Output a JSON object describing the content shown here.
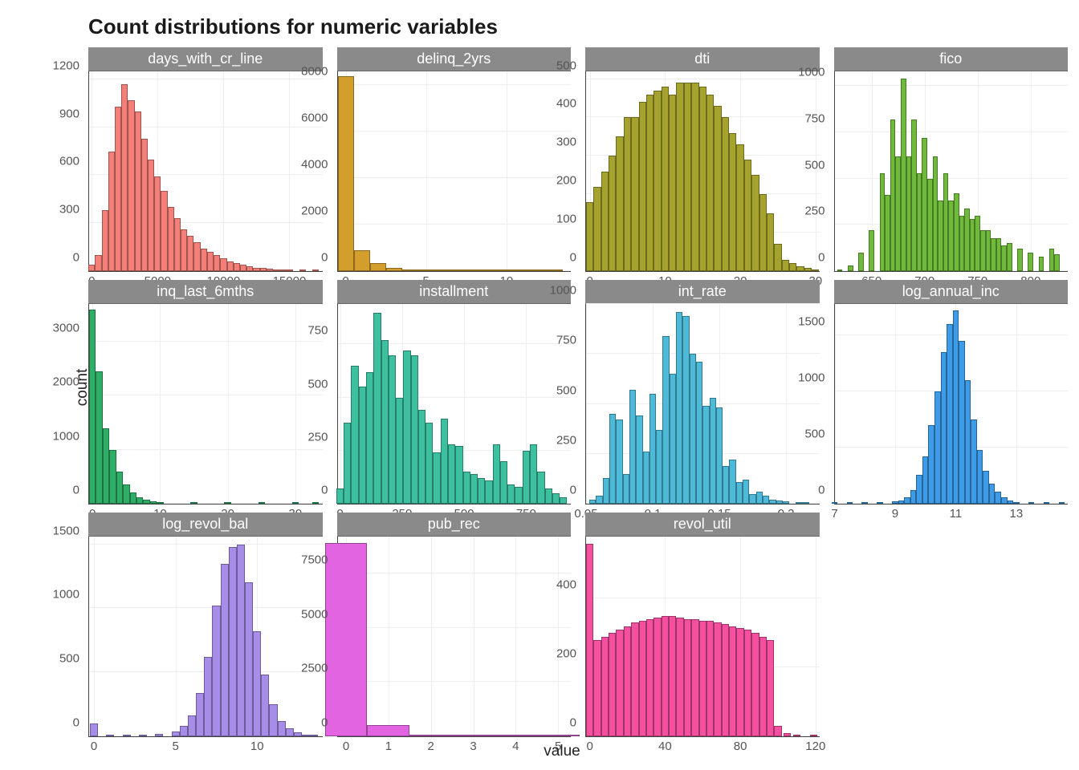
{
  "title": "Count distributions for numeric variables",
  "ylabel": "count",
  "xlabel": "value",
  "chart_data": [
    {
      "type": "bar",
      "name": "days_with_cr_line",
      "color": "#F47E78",
      "x": [
        0,
        500,
        1000,
        1500,
        2000,
        2500,
        3000,
        3500,
        4000,
        4500,
        5000,
        5500,
        6000,
        6500,
        7000,
        7500,
        8000,
        8500,
        9000,
        9500,
        10000,
        10500,
        11000,
        11500,
        12000,
        12500,
        13000,
        13500,
        14000,
        14500,
        15000,
        16000,
        17000
      ],
      "values": [
        40,
        100,
        380,
        750,
        1030,
        1170,
        1070,
        1000,
        830,
        700,
        590,
        500,
        400,
        330,
        260,
        220,
        180,
        140,
        120,
        100,
        80,
        60,
        50,
        40,
        30,
        22,
        18,
        14,
        10,
        8,
        6,
        4,
        2
      ],
      "x_ticks": [
        0,
        5000,
        10000,
        15000
      ],
      "y_ticks": [
        0,
        300,
        600,
        900,
        1200
      ],
      "xlim": [
        -200,
        17500
      ],
      "ylim": [
        0,
        1250
      ]
    },
    {
      "type": "bar",
      "name": "delinq_2yrs",
      "color": "#D39E2B",
      "x": [
        0,
        1,
        2,
        3,
        4,
        5,
        6,
        7,
        8,
        9,
        10,
        11,
        12,
        13
      ],
      "values": [
        8400,
        900,
        330,
        150,
        80,
        50,
        30,
        20,
        12,
        8,
        6,
        4,
        2,
        1
      ],
      "x_ticks": [
        0,
        5,
        10
      ],
      "y_ticks": [
        0,
        2000,
        4000,
        6000,
        8000
      ],
      "xlim": [
        -0.5,
        14
      ],
      "ylim": [
        0,
        8600
      ]
    },
    {
      "type": "bar",
      "name": "dti",
      "color": "#A5A22E",
      "x": [
        0,
        1,
        2,
        3,
        4,
        5,
        6,
        7,
        8,
        9,
        10,
        11,
        12,
        13,
        14,
        15,
        16,
        17,
        18,
        19,
        20,
        21,
        22,
        23,
        24,
        25,
        26,
        27,
        28,
        29,
        30
      ],
      "values": [
        180,
        220,
        260,
        300,
        350,
        400,
        400,
        440,
        460,
        470,
        480,
        460,
        490,
        490,
        490,
        480,
        460,
        430,
        400,
        360,
        330,
        290,
        250,
        200,
        150,
        70,
        30,
        20,
        12,
        8,
        5
      ],
      "x_ticks": [
        0,
        10,
        20,
        30
      ],
      "y_ticks": [
        0,
        100,
        200,
        300,
        400,
        500
      ],
      "xlim": [
        -0.5,
        30.5
      ],
      "ylim": [
        0,
        520
      ]
    },
    {
      "type": "bar",
      "name": "fico",
      "color": "#6FBA3A",
      "x": [
        620,
        630,
        640,
        650,
        660,
        665,
        670,
        675,
        680,
        685,
        690,
        695,
        700,
        705,
        710,
        715,
        720,
        725,
        730,
        735,
        740,
        745,
        750,
        755,
        760,
        765,
        770,
        775,
        780,
        790,
        800,
        810,
        820,
        825
      ],
      "values": [
        10,
        30,
        100,
        220,
        530,
        410,
        820,
        620,
        1040,
        620,
        820,
        530,
        720,
        500,
        620,
        380,
        530,
        380,
        420,
        300,
        340,
        280,
        300,
        220,
        220,
        180,
        180,
        140,
        150,
        120,
        100,
        80,
        120,
        90
      ],
      "x_ticks": [
        650,
        700,
        750,
        800
      ],
      "y_ticks": [
        0,
        250,
        500,
        750,
        1000
      ],
      "xlim": [
        615,
        835
      ],
      "ylim": [
        0,
        1080
      ]
    },
    {
      "type": "bar",
      "name": "inq_last_6mths",
      "color": "#2EAE66",
      "x": [
        0,
        1,
        2,
        3,
        4,
        5,
        6,
        7,
        8,
        9,
        10,
        15,
        20,
        25,
        30,
        33
      ],
      "values": [
        3600,
        2450,
        1400,
        990,
        600,
        350,
        210,
        120,
        80,
        50,
        30,
        10,
        5,
        3,
        2,
        1
      ],
      "x_ticks": [
        0,
        10,
        20,
        30
      ],
      "y_ticks": [
        0,
        1000,
        2000,
        3000
      ],
      "xlim": [
        -0.5,
        34
      ],
      "ylim": [
        0,
        3700
      ]
    },
    {
      "type": "bar",
      "name": "installment",
      "color": "#3DC0A0",
      "x": [
        0,
        30,
        60,
        90,
        120,
        150,
        180,
        210,
        240,
        270,
        300,
        330,
        360,
        390,
        420,
        450,
        480,
        510,
        540,
        570,
        600,
        630,
        660,
        690,
        720,
        750,
        780,
        810,
        840,
        870,
        900
      ],
      "values": [
        70,
        380,
        650,
        550,
        620,
        900,
        770,
        700,
        500,
        720,
        700,
        440,
        380,
        240,
        400,
        280,
        270,
        150,
        140,
        120,
        110,
        280,
        200,
        90,
        80,
        250,
        280,
        150,
        70,
        50,
        30
      ],
      "x_ticks": [
        0,
        250,
        500,
        750
      ],
      "y_ticks": [
        0,
        250,
        500,
        750
      ],
      "xlim": [
        -10,
        930
      ],
      "ylim": [
        0,
        940
      ]
    },
    {
      "type": "bar",
      "name": "int_rate",
      "color": "#4EBADA",
      "x": [
        0.055,
        0.06,
        0.065,
        0.07,
        0.075,
        0.08,
        0.085,
        0.09,
        0.095,
        0.1,
        0.105,
        0.11,
        0.115,
        0.12,
        0.125,
        0.13,
        0.135,
        0.14,
        0.145,
        0.15,
        0.155,
        0.16,
        0.165,
        0.17,
        0.175,
        0.18,
        0.185,
        0.19,
        0.195,
        0.2,
        0.21,
        0.215
      ],
      "values": [
        20,
        40,
        130,
        450,
        420,
        150,
        570,
        440,
        260,
        550,
        370,
        840,
        650,
        960,
        940,
        750,
        710,
        490,
        530,
        480,
        190,
        220,
        110,
        120,
        50,
        60,
        40,
        20,
        15,
        12,
        8,
        5
      ],
      "x_ticks": [
        0.05,
        0.1,
        0.15,
        0.2
      ],
      "y_ticks": [
        0,
        250,
        500,
        750,
        1000
      ],
      "xlim": [
        0.05,
        0.225
      ],
      "ylim": [
        0,
        1000
      ]
    },
    {
      "type": "bar",
      "name": "log_annual_inc",
      "color": "#3E9BE8",
      "x": [
        7.0,
        7.5,
        8.0,
        8.5,
        9.0,
        9.2,
        9.4,
        9.6,
        9.8,
        10.0,
        10.2,
        10.4,
        10.6,
        10.8,
        11.0,
        11.2,
        11.4,
        11.6,
        11.8,
        12.0,
        12.2,
        12.4,
        12.6,
        12.8,
        13.0,
        13.5,
        14.0,
        14.5
      ],
      "values": [
        2,
        3,
        5,
        10,
        20,
        30,
        60,
        120,
        260,
        420,
        700,
        1000,
        1350,
        1600,
        1720,
        1450,
        1100,
        750,
        480,
        290,
        180,
        110,
        60,
        30,
        15,
        8,
        4,
        2
      ],
      "x_ticks": [
        7,
        9,
        11,
        13
      ],
      "y_ticks": [
        0,
        500,
        1000,
        1500
      ],
      "xlim": [
        7,
        14.7
      ],
      "ylim": [
        0,
        1780
      ]
    },
    {
      "type": "bar",
      "name": "log_revol_bal",
      "color": "#A78CE8",
      "x": [
        0,
        1,
        2,
        3,
        4,
        5,
        5.5,
        6,
        6.5,
        7,
        7.5,
        8,
        8.5,
        9,
        9.5,
        10,
        10.5,
        11,
        11.5,
        12,
        12.5,
        13,
        13.5
      ],
      "values": [
        100,
        3,
        6,
        10,
        20,
        40,
        80,
        160,
        340,
        620,
        1020,
        1350,
        1480,
        1500,
        1200,
        820,
        480,
        250,
        120,
        60,
        30,
        15,
        6
      ],
      "x_ticks": [
        0,
        5,
        10
      ],
      "y_ticks": [
        0,
        500,
        1000,
        1500
      ],
      "xlim": [
        -0.3,
        14
      ],
      "ylim": [
        0,
        1560
      ]
    },
    {
      "type": "bar",
      "name": "pub_rec",
      "color": "#E264E0",
      "x": [
        0,
        1,
        2,
        3,
        4,
        5
      ],
      "values": [
        8900,
        520,
        60,
        20,
        10,
        3
      ],
      "x_ticks": [
        0,
        1,
        2,
        3,
        4,
        5
      ],
      "y_ticks": [
        0,
        2500,
        5000,
        7500
      ],
      "xlim": [
        -0.2,
        5.3
      ],
      "ylim": [
        0,
        9200
      ]
    },
    {
      "type": "bar",
      "name": "revol_util",
      "color": "#F54FA0",
      "x": [
        0,
        4,
        8,
        12,
        16,
        20,
        24,
        28,
        32,
        36,
        40,
        44,
        48,
        52,
        56,
        60,
        64,
        68,
        72,
        76,
        80,
        84,
        88,
        92,
        96,
        100,
        105,
        110,
        119
      ],
      "values": [
        560,
        280,
        290,
        300,
        310,
        320,
        330,
        335,
        340,
        345,
        350,
        350,
        345,
        340,
        340,
        335,
        335,
        330,
        325,
        320,
        315,
        310,
        300,
        290,
        280,
        30,
        10,
        5,
        2
      ],
      "x_ticks": [
        0,
        40,
        80,
        120
      ],
      "y_ticks": [
        0,
        200,
        400
      ],
      "xlim": [
        -2,
        122
      ],
      "ylim": [
        0,
        580
      ]
    }
  ]
}
